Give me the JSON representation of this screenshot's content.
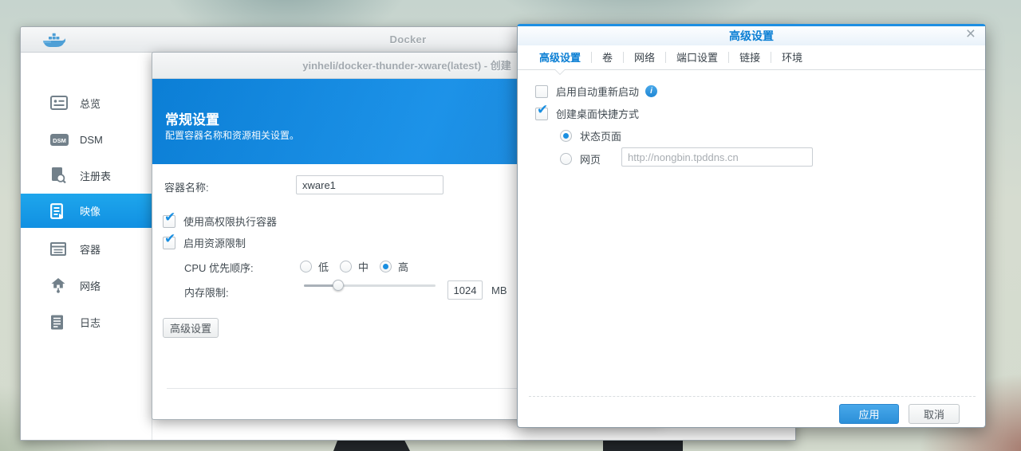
{
  "app": {
    "window_title": "Docker",
    "sidebar": {
      "items": [
        {
          "label": "总览",
          "icon": "overview-icon",
          "selected": false
        },
        {
          "label": "DSM",
          "icon": "dsm-icon",
          "selected": false
        },
        {
          "label": "注册表",
          "icon": "registry-icon",
          "selected": false
        },
        {
          "label": "映像",
          "icon": "image-icon",
          "selected": true
        },
        {
          "label": "容器",
          "icon": "container-icon",
          "selected": false
        },
        {
          "label": "网络",
          "icon": "network-icon",
          "selected": false
        },
        {
          "label": "日志",
          "icon": "log-icon",
          "selected": false
        }
      ]
    }
  },
  "create_dialog": {
    "title": "yinheli/docker-thunder-xware(latest) - 创建",
    "header": {
      "title": "常规设置",
      "subtitle": "配置容器名称和资源相关设置。"
    },
    "form": {
      "container_name_label": "容器名称:",
      "container_name_value": "xware1",
      "privileged_checkbox_label": "使用高权限执行容器",
      "privileged_checked": true,
      "resource_limit_checkbox_label": "启用资源限制",
      "resource_limit_checked": true,
      "cpu_priority_label": "CPU 优先顺序:",
      "cpu_options": [
        "低",
        "中",
        "高"
      ],
      "cpu_selected": "高",
      "memory_limit_label": "内存限制:",
      "memory_value": "1024",
      "memory_unit": "MB",
      "memory_slider_percent": 26,
      "advanced_settings_button": "高级设置"
    }
  },
  "advanced_dialog": {
    "title": "高级设置",
    "tabs": [
      {
        "label": "高级设置",
        "active": true
      },
      {
        "label": "卷",
        "active": false
      },
      {
        "label": "网络",
        "active": false
      },
      {
        "label": "端口设置",
        "active": false
      },
      {
        "label": "链接",
        "active": false
      },
      {
        "label": "环境",
        "active": false
      }
    ],
    "form": {
      "auto_restart_label": "启用自动重新启动",
      "auto_restart_checked": false,
      "shortcut_label": "创建桌面快捷方式",
      "shortcut_checked": true,
      "shortcut_options": [
        {
          "label": "状态页面",
          "selected": true
        },
        {
          "label": "网页",
          "selected": false
        }
      ],
      "web_url_value": "http://nongbin.tpddns.cn"
    },
    "buttons": {
      "apply": "应用",
      "cancel": "取消"
    }
  },
  "colors": {
    "accent_blue": "#1e8fe2",
    "dialog_title_blue": "#0b7fd4",
    "header_gradient": "#0d86df",
    "selected_item_blue": "#1698e8",
    "check_blue": "#1a8fe1",
    "apply_button_blue": "#2f97e0"
  }
}
